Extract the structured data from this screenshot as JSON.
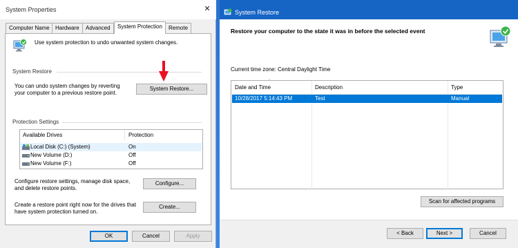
{
  "system_properties": {
    "title": "System Properties",
    "close_glyph": "✕",
    "tabs": [
      {
        "label": "Computer Name"
      },
      {
        "label": "Hardware"
      },
      {
        "label": "Advanced"
      },
      {
        "label": "System Protection"
      },
      {
        "label": "Remote"
      }
    ],
    "active_tab": "System Protection",
    "intro": "Use system protection to undo unwanted system changes.",
    "system_restore": {
      "group_label": "System Restore",
      "description": "You can undo system changes by reverting your computer to a previous restore point.",
      "button_label": "System Restore..."
    },
    "protection": {
      "group_label": "Protection Settings",
      "columns": [
        "Available Drives",
        "Protection"
      ],
      "drives": [
        {
          "name": "Local Disk (C:) (System)",
          "protection": "On"
        },
        {
          "name": "New Volume (D:)",
          "protection": "Off"
        },
        {
          "name": "New Volume (F:)",
          "protection": "Off"
        }
      ]
    },
    "configure": {
      "description": "Configure restore settings, manage disk space, and delete restore points.",
      "button_label": "Configure..."
    },
    "create": {
      "description": "Create a restore point right now for the drives that have system protection turned on.",
      "button_label": "Create..."
    },
    "footer": {
      "ok": "OK",
      "cancel": "Cancel",
      "apply": "Apply"
    }
  },
  "system_restore_wizard": {
    "title": "System Restore",
    "heading": "Restore your computer to the state it was in before the selected event",
    "timezone": "Current time zone: Central Daylight Time",
    "columns": [
      "Date and Time",
      "Description",
      "Type"
    ],
    "restore_points": [
      {
        "date": "10/28/2017 5:14:43 PM",
        "description": "Test",
        "type": "Manual"
      }
    ],
    "scan_button": "Scan for affected programs",
    "footer": {
      "back": "< Back",
      "next": "Next >",
      "cancel": "Cancel"
    }
  },
  "colors": {
    "desktop": "#2a6fd0",
    "wizard_titlebar": "#1664c4",
    "selection": "#0078d7",
    "arrow": "#e81123"
  }
}
